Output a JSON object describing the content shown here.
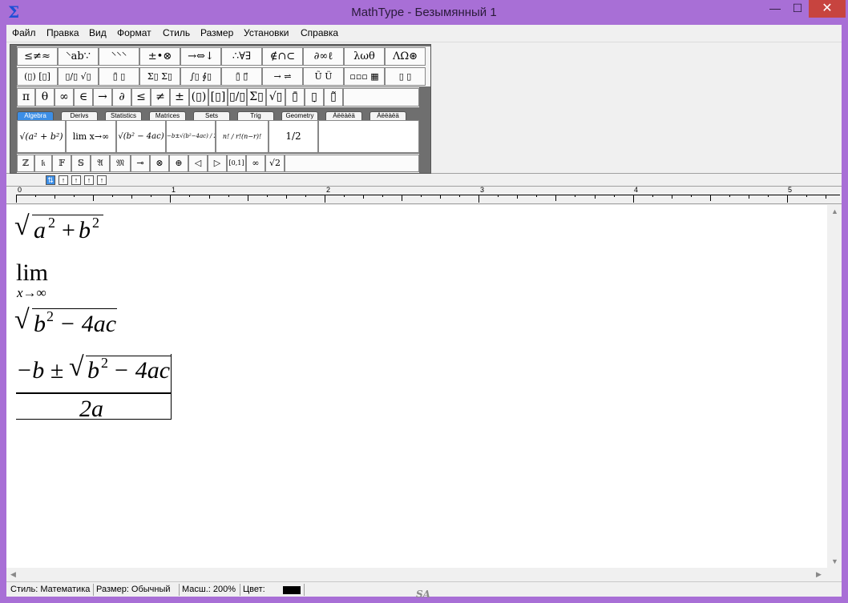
{
  "window": {
    "title": "MathType - Безымянный 1",
    "app_icon": "Σ",
    "controls": {
      "minimize": "—",
      "maximize": "☐",
      "close": "✕"
    }
  },
  "menu": [
    "Файл",
    "Правка",
    "Вид",
    "Формат",
    "Стиль",
    "Размер",
    "Установки",
    "Справка"
  ],
  "toolbar": {
    "row1": [
      "≤≠≈",
      "⸌ab∵",
      "⸌⸌⸌",
      "±•⊗",
      "→⇔↓",
      "∴∀∃",
      "∉∩⊂",
      "∂∞ℓ",
      "λωθ",
      "ΛΩ⊛"
    ],
    "row2": [
      "(▯) [▯]",
      "▯/▯ √▯",
      "▯̄ ▯",
      "Σ▯ Σ▯",
      "∫▯ ∮▯",
      "▯̄ ▯⃗",
      "→ ⇌",
      "Ũ Ü",
      "▫▫▫ ▦",
      "▯ ▯"
    ],
    "symbols": [
      "π",
      "θ",
      "∞",
      "∈",
      "→",
      "∂",
      "≤",
      "≠",
      "±",
      "(▯)",
      "[▯]",
      "▯/▯",
      "Σ▯",
      "√▯",
      "▯̄",
      "▯̣",
      "▯̃"
    ],
    "tabs": [
      "Algebra",
      "Derivs",
      "Statistics",
      "Matrices",
      "Sets",
      "Trig",
      "Geometry",
      "Àëëàëä",
      "Àëëàëä"
    ],
    "active_tab": "Algebra",
    "templates": [
      "√(a² + b²)",
      "lim x→∞",
      "√(b² − 4ac)",
      "−b±√(b²−4ac) / 2a",
      "n! / r!(n−r)!",
      "1/2"
    ],
    "small": [
      "ℤ",
      "𝔨",
      "𝔽",
      "𝕊",
      "𝔄",
      "𝔐",
      "⊸",
      "⊗",
      "⊕",
      "◁",
      "▷",
      "[0,1]",
      "∞",
      "√2"
    ]
  },
  "nudge_buttons": [
    "⇅",
    "↑",
    "↑",
    "↑",
    "↑"
  ],
  "ruler": {
    "labels": [
      "0",
      "1",
      "2",
      "3",
      "4",
      "5"
    ]
  },
  "editor": {
    "eq1": {
      "a": "a",
      "b": "b",
      "two_a": "2",
      "two_b": "2",
      "plus": "+"
    },
    "eq2": {
      "lim": "lim",
      "sub": "x→∞"
    },
    "eq3": {
      "b": "b",
      "two": "2",
      "rest": "− 4ac"
    },
    "eq4": {
      "neg": "−b ±",
      "b": "b",
      "two": "2",
      "rest": "− 4ac",
      "den": "2a"
    }
  },
  "status": {
    "style": "Стиль: Математика",
    "size": "Размер: Обычный",
    "zoom": "Масш.: 200%",
    "color_label": "Цвет:",
    "color": "#000000"
  },
  "watermark": "SA"
}
